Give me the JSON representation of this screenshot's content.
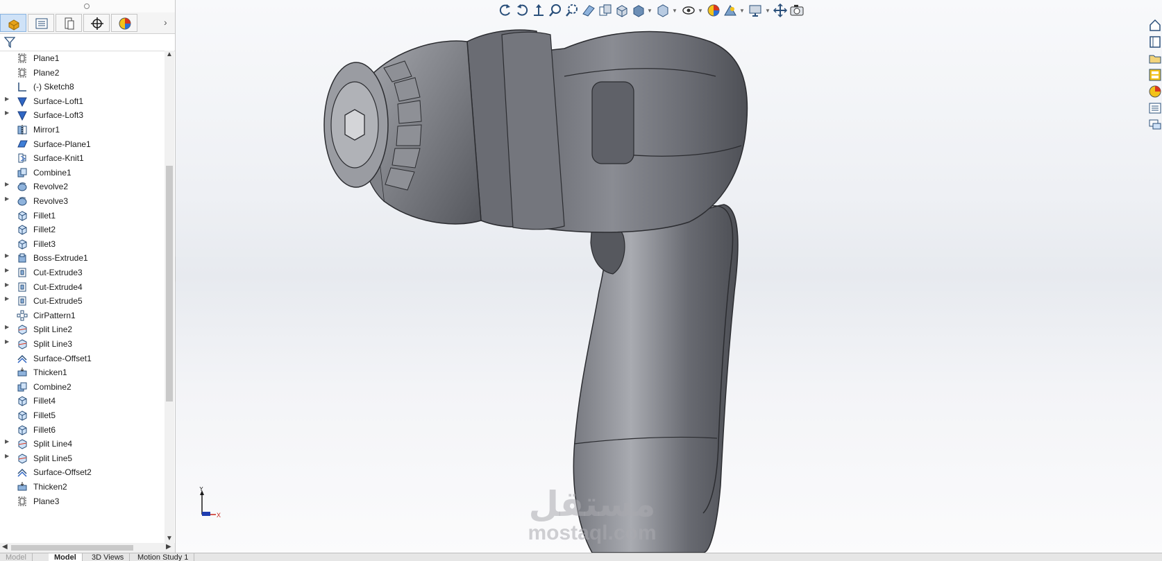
{
  "feature_tree": [
    {
      "label": "Plane1",
      "icon": "plane-icon",
      "expandable": false
    },
    {
      "label": "Plane2",
      "icon": "plane-icon",
      "expandable": false
    },
    {
      "label": "(-) Sketch8",
      "icon": "sketch-icon",
      "expandable": false
    },
    {
      "label": "Surface-Loft1",
      "icon": "surface-loft-icon",
      "expandable": true
    },
    {
      "label": "Surface-Loft3",
      "icon": "surface-loft-icon",
      "expandable": true
    },
    {
      "label": "Mirror1",
      "icon": "mirror-icon",
      "expandable": false
    },
    {
      "label": "Surface-Plane1",
      "icon": "surface-plane-icon",
      "expandable": false
    },
    {
      "label": "Surface-Knit1",
      "icon": "surface-knit-icon",
      "expandable": false
    },
    {
      "label": "Combine1",
      "icon": "combine-icon",
      "expandable": false
    },
    {
      "label": "Revolve2",
      "icon": "revolve-icon",
      "expandable": true
    },
    {
      "label": "Revolve3",
      "icon": "revolve-icon",
      "expandable": true
    },
    {
      "label": "Fillet1",
      "icon": "fillet-icon",
      "expandable": false
    },
    {
      "label": "Fillet2",
      "icon": "fillet-icon",
      "expandable": false
    },
    {
      "label": "Fillet3",
      "icon": "fillet-icon",
      "expandable": false
    },
    {
      "label": "Boss-Extrude1",
      "icon": "boss-extrude-icon",
      "expandable": true
    },
    {
      "label": "Cut-Extrude3",
      "icon": "cut-extrude-icon",
      "expandable": true
    },
    {
      "label": "Cut-Extrude4",
      "icon": "cut-extrude-icon",
      "expandable": true
    },
    {
      "label": "Cut-Extrude5",
      "icon": "cut-extrude-icon",
      "expandable": true
    },
    {
      "label": "CirPattern1",
      "icon": "circular-pattern-icon",
      "expandable": false
    },
    {
      "label": "Split Line2",
      "icon": "split-line-icon",
      "expandable": true
    },
    {
      "label": "Split Line3",
      "icon": "split-line-icon",
      "expandable": true
    },
    {
      "label": "Surface-Offset1",
      "icon": "surface-offset-icon",
      "expandable": false
    },
    {
      "label": "Thicken1",
      "icon": "thicken-icon",
      "expandable": false
    },
    {
      "label": "Combine2",
      "icon": "combine-icon",
      "expandable": false
    },
    {
      "label": "Fillet4",
      "icon": "fillet-icon",
      "expandable": false
    },
    {
      "label": "Fillet5",
      "icon": "fillet-icon",
      "expandable": false
    },
    {
      "label": "Fillet6",
      "icon": "fillet-icon",
      "expandable": false
    },
    {
      "label": "Split Line4",
      "icon": "split-line-icon",
      "expandable": true
    },
    {
      "label": "Split Line5",
      "icon": "split-line-icon",
      "expandable": true
    },
    {
      "label": "Surface-Offset2",
      "icon": "surface-offset-icon",
      "expandable": false
    },
    {
      "label": "Thicken2",
      "icon": "thicken-icon",
      "expandable": false
    },
    {
      "label": "Plane3",
      "icon": "plane-icon",
      "expandable": false
    }
  ],
  "manager_tabs": [
    "feature-manager-icon",
    "property-manager-icon",
    "configuration-manager-icon",
    "dimxpert-manager-icon",
    "display-manager-icon"
  ],
  "bottom_tabs": {
    "left_hidden": "Model",
    "model": "Model",
    "views_3d": "3D Views",
    "motion": "Motion Study 1"
  },
  "triad": {
    "y": "Y",
    "x": "X"
  },
  "watermark": {
    "arabic": "مستقل",
    "latin": "mostaql.com"
  },
  "colors": {
    "model_body": "#6e7077",
    "active_tab": "#cfe2f7"
  }
}
